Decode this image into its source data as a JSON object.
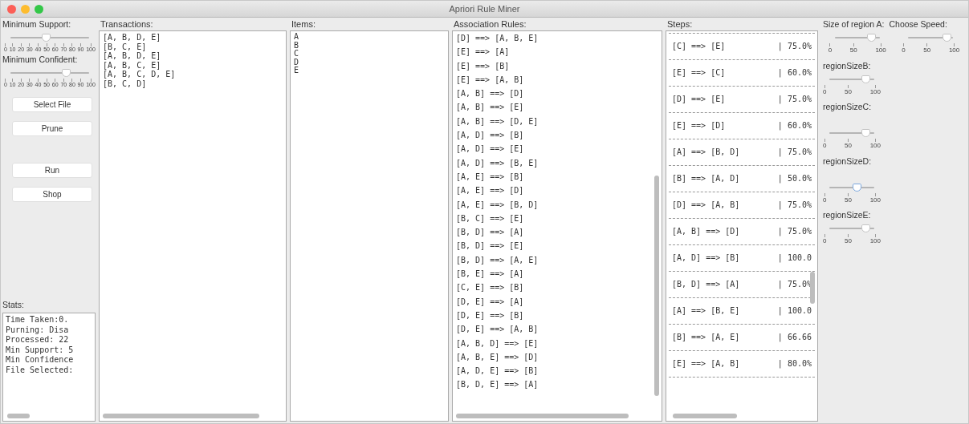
{
  "window": {
    "title": "Apriori Rule Miner"
  },
  "left_panel": {
    "sliders": [
      {
        "label": "Minimum Support:",
        "level": 0.45,
        "ticks": [
          "0",
          "10",
          "20",
          "30",
          "40",
          "50",
          "60",
          "70",
          "80",
          "90",
          "100"
        ]
      },
      {
        "label": "Minimum Confident:",
        "level": 0.7,
        "ticks": [
          "0",
          "10",
          "20",
          "30",
          "40",
          "50",
          "60",
          "70",
          "80",
          "90",
          "100"
        ]
      }
    ],
    "button_groups": [
      [
        "Select File",
        "Prune"
      ],
      [
        "Run",
        "Shop"
      ]
    ],
    "stats_label": "Stats:",
    "stats": [
      "Time Taken:0.",
      "Purning: Disa",
      "Processed: 22",
      "Min Support: 5",
      "Min Confidence",
      "File Selected:"
    ]
  },
  "transactions": {
    "label": "Transactions:",
    "rows": [
      "[A, B, D, E]",
      "[B, C, E]",
      "[A, B, D, E]",
      "[A, B, C, E]",
      "[A, B, C, D, E]",
      "[B, C, D]"
    ]
  },
  "items": {
    "label": "Items:",
    "rows": [
      "A",
      "B",
      "C",
      "D",
      "E"
    ]
  },
  "rules": {
    "label": "Association Rules:",
    "rows": [
      "[D] ==> [A, B, E]",
      "[E] ==> [A]",
      "[E] ==> [B]",
      "[E] ==> [A, B]",
      "[A, B] ==> [D]",
      "[A, B] ==> [E]",
      "[A, B] ==> [D, E]",
      "[A, D] ==> [B]",
      "[A, D] ==> [E]",
      "[A, D] ==> [B, E]",
      "[A, E] ==> [B]",
      "[A, E] ==> [D]",
      "[A, E] ==> [B, D]",
      "[B, C] ==> [E]",
      "[B, D] ==> [A]",
      "[B, D] ==> [E]",
      "[B, D] ==> [A, E]",
      "[B, E] ==> [A]",
      "[C, E] ==> [B]",
      "[D, E] ==> [A]",
      "[D, E] ==> [B]",
      "[D, E] ==> [A, B]",
      "[A, B, D] ==> [E]",
      "[A, B, E] ==> [D]",
      "[A, D, E] ==> [B]",
      "[B, D, E] ==> [A]"
    ]
  },
  "steps": {
    "label": "Steps:",
    "rows": [
      {
        "rule": "[C] ==> [E]",
        "confidence": "| 75.0%"
      },
      {
        "rule": "[E] ==> [C]",
        "confidence": "| 60.0%"
      },
      {
        "rule": "[D] ==> [E]",
        "confidence": "| 75.0%"
      },
      {
        "rule": "[E] ==> [D]",
        "confidence": "| 60.0%"
      },
      {
        "rule": "[A] ==> [B, D]",
        "confidence": "| 75.0%"
      },
      {
        "rule": "[B] ==> [A, D]",
        "confidence": "| 50.0%"
      },
      {
        "rule": "[D] ==> [A, B]",
        "confidence": "| 75.0%"
      },
      {
        "rule": "[A, B] ==> [D]",
        "confidence": "| 75.0%"
      },
      {
        "rule": "[A, D] ==> [B]",
        "confidence": "| 100.0"
      },
      {
        "rule": "[B, D] ==> [A]",
        "confidence": "| 75.0%"
      },
      {
        "rule": "[A] ==> [B, E]",
        "confidence": "| 100.0"
      },
      {
        "rule": "[B] ==> [A, E]",
        "confidence": "| 66.66"
      },
      {
        "rule": "[E] ==> [A, B]",
        "confidence": "| 80.0%"
      }
    ]
  },
  "right_panel": {
    "top_labels": [
      "Size of region A:",
      "Choose Speed:"
    ],
    "top_sliders": [
      {
        "level": 0.8,
        "focused": false,
        "ticks": [
          "0",
          "50",
          "100"
        ]
      },
      {
        "level": 0.85,
        "focused": false,
        "ticks": [
          "0",
          "50",
          "100"
        ]
      }
    ],
    "sliders": [
      {
        "label": "regionSizeB:",
        "level": 0.8,
        "focused": false,
        "ticks": [
          "0",
          "50",
          "100"
        ]
      },
      {
        "label": "regionSizeC:",
        "level": 0.8,
        "focused": false,
        "ticks": [
          "0",
          "50",
          "100"
        ]
      },
      {
        "label": "regionSizeD:",
        "level": 0.6,
        "focused": true,
        "ticks": [
          "0",
          "50",
          "100"
        ]
      },
      {
        "label": "regionSizeE:",
        "level": 0.8,
        "focused": false,
        "ticks": [
          "0",
          "50",
          "100"
        ]
      }
    ]
  }
}
